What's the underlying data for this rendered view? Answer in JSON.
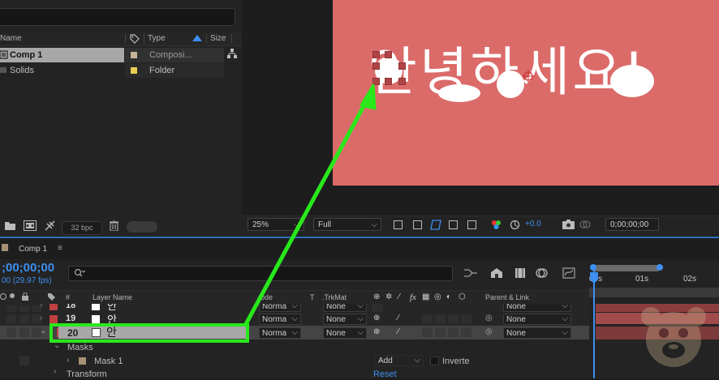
{
  "project": {
    "columns": {
      "name": "Name",
      "type": "Type",
      "size": "Size"
    },
    "items": [
      {
        "name": "Comp 1",
        "type": "Composi...",
        "selected": true,
        "label_color": "#c7b299"
      },
      {
        "name": "Solids",
        "type": "Folder",
        "selected": false,
        "label_color": "#e8cf4f"
      }
    ],
    "bpc": "32 bpc"
  },
  "viewer": {
    "canvas_color": "#db6b69",
    "text": "안녕하세요!",
    "zoom": "25%",
    "resolution": "Full",
    "exposure": "+0.0",
    "timecode": "0;00;00;00"
  },
  "timeline": {
    "tab_label": "Comp 1",
    "timecode": ";00;00;00",
    "fps": "00 (29.97 fps)",
    "columns": {
      "hash": "#",
      "layer_name": "Layer Name",
      "mode": "ode",
      "t": "T",
      "trkmat": ".TrkMat",
      "fx": "fx",
      "parent": "Parent & Link"
    },
    "ruler": [
      "00s",
      "01s",
      "02s"
    ],
    "layers": [
      {
        "num": "18",
        "name": "안",
        "mode": "Norma",
        "trkmat": "None",
        "parent": "None",
        "selected": false
      },
      {
        "num": "19",
        "name": "안",
        "mode": "Norma",
        "trkmat": "None",
        "parent": "None",
        "selected": false
      },
      {
        "num": "20",
        "name": "안",
        "mode": "Norma",
        "trkmat": "None",
        "parent": "None",
        "selected": true
      }
    ],
    "masks_label": "Masks",
    "mask1": {
      "name": "Mask 1",
      "mode": "Add",
      "inverted_label": "Inverte"
    },
    "transform": {
      "label": "Transform",
      "reset": "Reset"
    }
  },
  "annotation": {
    "color": "#29e81b"
  }
}
